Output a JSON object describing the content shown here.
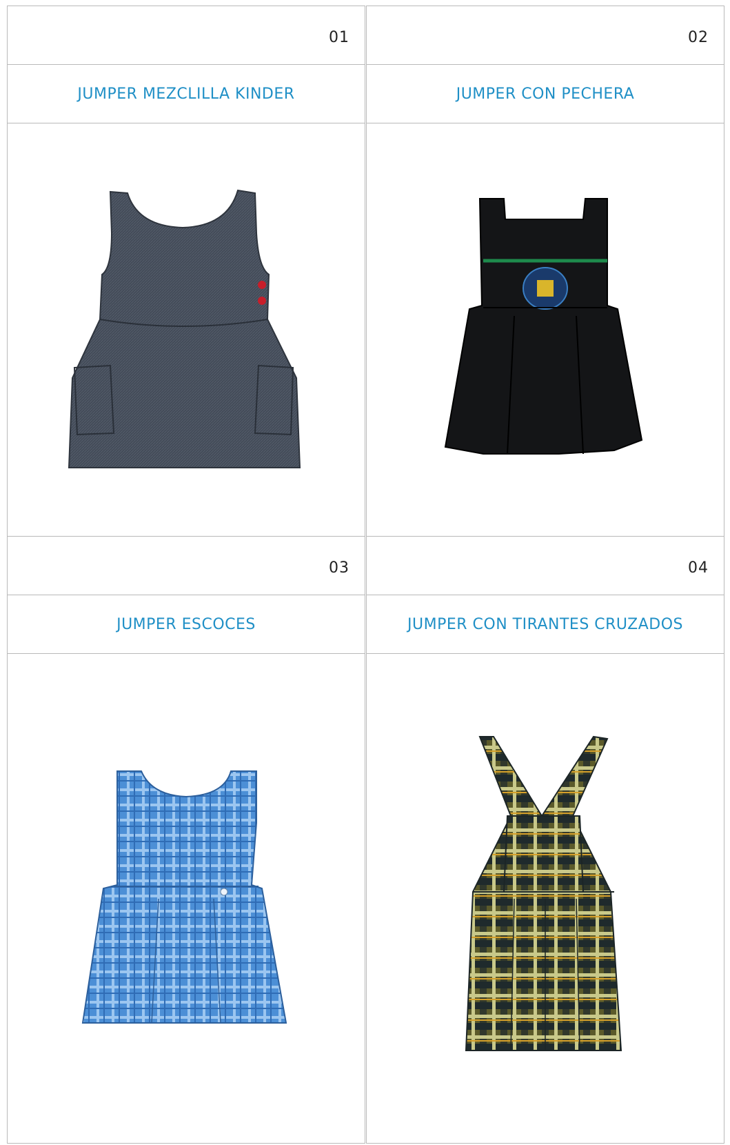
{
  "products": [
    {
      "number": "01",
      "name": "JUMPER MEZCLILLA KINDER",
      "image_icon": "denim-jumper-icon",
      "color": "#3d4450"
    },
    {
      "number": "02",
      "name": "JUMPER CON PECHERA",
      "image_icon": "black-pinafore-icon",
      "color": "#141517"
    },
    {
      "number": "03",
      "name": "JUMPER ESCOCES",
      "image_icon": "blue-plaid-jumper-icon",
      "color": "#4d8fd6"
    },
    {
      "number": "04",
      "name": "JUMPER CON TIRANTES CRUZADOS",
      "image_icon": "plaid-crossed-strap-jumper-icon",
      "color": "#5b5a2a"
    }
  ],
  "accent": "#1f8fc6"
}
